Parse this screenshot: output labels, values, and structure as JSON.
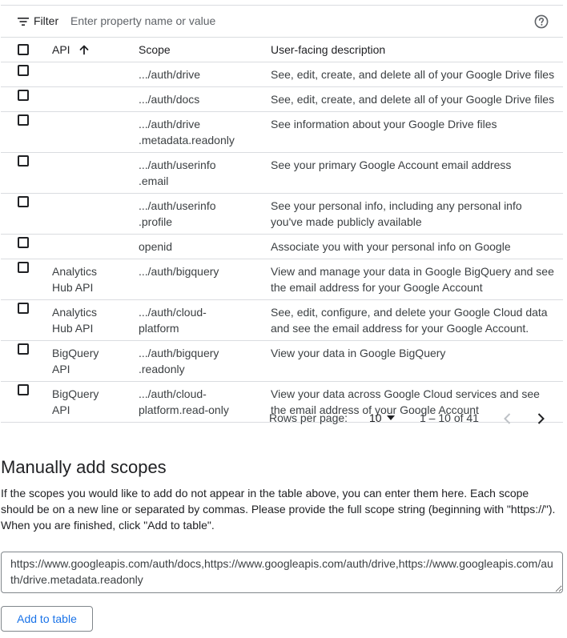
{
  "filter": {
    "label": "Filter",
    "placeholder": "Enter property name or value",
    "value": ""
  },
  "table": {
    "headers": {
      "api": "API",
      "scope": "Scope",
      "description": "User-facing description"
    },
    "sort": {
      "column": "api",
      "direction": "ascending"
    },
    "rows": [
      {
        "api": "",
        "scope": ".../auth/drive",
        "description": "See, edit, create, and delete all of your Google Drive files"
      },
      {
        "api": "",
        "scope": ".../auth/docs",
        "description": "See, edit, create, and delete all of your Google Drive files"
      },
      {
        "api": "",
        "scope": ".../auth/drive\n.metadata.readonly",
        "description": "See information about your Google Drive files"
      },
      {
        "api": "",
        "scope": ".../auth/userinfo\n.email",
        "description": "See your primary Google Account email address"
      },
      {
        "api": "",
        "scope": ".../auth/userinfo\n.profile",
        "description": "See your personal info, including any personal info\nyou've made publicly available"
      },
      {
        "api": "",
        "scope": "openid",
        "description": "Associate you with your personal info on Google"
      },
      {
        "api": "Analytics\nHub API",
        "scope": ".../auth/bigquery",
        "description": "View and manage your data in Google BigQuery and see\nthe email address for your Google Account"
      },
      {
        "api": "Analytics\nHub API",
        "scope": ".../auth/cloud-\nplatform",
        "description": "See, edit, configure, and delete your Google Cloud data\nand see the email address for your Google Account."
      },
      {
        "api": "BigQuery\nAPI",
        "scope": ".../auth/bigquery\n.readonly",
        "description": "View your data in Google BigQuery"
      },
      {
        "api": "BigQuery\nAPI",
        "scope": ".../auth/cloud-\nplatform.read-only",
        "description": "View your data across Google Cloud services and see\nthe email address of your Google Account"
      }
    ]
  },
  "pagination": {
    "rows_per_page_label": "Rows per page:",
    "rows_per_page_value": "10",
    "range_label": "1 – 10 of 41"
  },
  "manual": {
    "title": "Manually add scopes",
    "description": "If the scopes you would like to add do not appear in the table above, you can enter them here. Each scope should be on a new line or separated by commas. Please provide the full scope string (beginning with \"https://\"). When you are finished, click \"Add to table\".",
    "textarea_value": "https://www.googleapis.com/auth/docs,https://www.googleapis.com/auth/drive,https://www.googleapis.com/auth/drive.metadata.readonly",
    "add_button_label": "Add to table"
  },
  "icons": {
    "filter": "filter-icon",
    "help": "help-circle-icon",
    "sort": "arrow-up-icon",
    "caret": "caret-down-icon",
    "prev": "chevron-left-icon",
    "next": "chevron-right-icon"
  },
  "colors": {
    "accent": "#1a73e8",
    "border": "#dadce0",
    "text": "#3c4043",
    "disabled": "#bdc1c6"
  }
}
